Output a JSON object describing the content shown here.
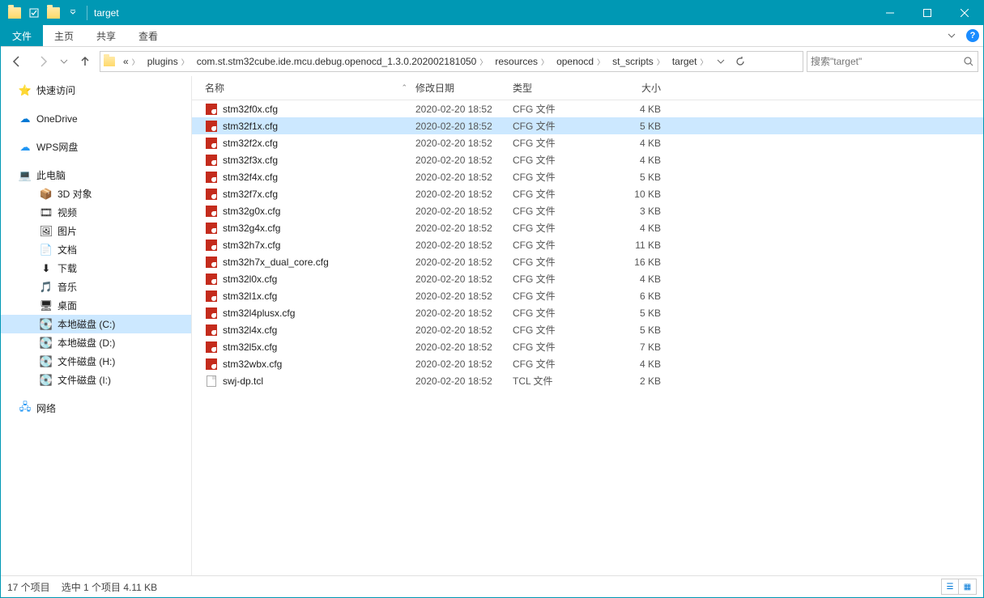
{
  "window": {
    "title": "target"
  },
  "ribbon": {
    "file": "文件",
    "home": "主页",
    "share": "共享",
    "view": "查看"
  },
  "breadcrumbs": [
    "«",
    "plugins",
    "com.st.stm32cube.ide.mcu.debug.openocd_1.3.0.202002181050",
    "resources",
    "openocd",
    "st_scripts",
    "target"
  ],
  "search": {
    "placeholder": "搜索\"target\""
  },
  "nav": {
    "quickaccess": "快速访问",
    "onedrive": "OneDrive",
    "wps": "WPS网盘",
    "thispc": "此电脑",
    "pc_items": [
      "3D 对象",
      "视频",
      "图片",
      "文档",
      "下载",
      "音乐",
      "桌面",
      "本地磁盘 (C:)",
      "本地磁盘 (D:)",
      "文件磁盘 (H:)",
      "文件磁盘 (I:)"
    ],
    "network": "网络"
  },
  "columns": {
    "name": "名称",
    "date": "修改日期",
    "type": "类型",
    "size": "大小"
  },
  "files": [
    {
      "name": "stm32f0x.cfg",
      "date": "2020-02-20 18:52",
      "type": "CFG 文件",
      "size": "4 KB",
      "icon": "cfg"
    },
    {
      "name": "stm32f1x.cfg",
      "date": "2020-02-20 18:52",
      "type": "CFG 文件",
      "size": "5 KB",
      "icon": "cfg",
      "selected": true
    },
    {
      "name": "stm32f2x.cfg",
      "date": "2020-02-20 18:52",
      "type": "CFG 文件",
      "size": "4 KB",
      "icon": "cfg"
    },
    {
      "name": "stm32f3x.cfg",
      "date": "2020-02-20 18:52",
      "type": "CFG 文件",
      "size": "4 KB",
      "icon": "cfg"
    },
    {
      "name": "stm32f4x.cfg",
      "date": "2020-02-20 18:52",
      "type": "CFG 文件",
      "size": "5 KB",
      "icon": "cfg"
    },
    {
      "name": "stm32f7x.cfg",
      "date": "2020-02-20 18:52",
      "type": "CFG 文件",
      "size": "10 KB",
      "icon": "cfg"
    },
    {
      "name": "stm32g0x.cfg",
      "date": "2020-02-20 18:52",
      "type": "CFG 文件",
      "size": "3 KB",
      "icon": "cfg"
    },
    {
      "name": "stm32g4x.cfg",
      "date": "2020-02-20 18:52",
      "type": "CFG 文件",
      "size": "4 KB",
      "icon": "cfg"
    },
    {
      "name": "stm32h7x.cfg",
      "date": "2020-02-20 18:52",
      "type": "CFG 文件",
      "size": "11 KB",
      "icon": "cfg"
    },
    {
      "name": "stm32h7x_dual_core.cfg",
      "date": "2020-02-20 18:52",
      "type": "CFG 文件",
      "size": "16 KB",
      "icon": "cfg"
    },
    {
      "name": "stm32l0x.cfg",
      "date": "2020-02-20 18:52",
      "type": "CFG 文件",
      "size": "4 KB",
      "icon": "cfg"
    },
    {
      "name": "stm32l1x.cfg",
      "date": "2020-02-20 18:52",
      "type": "CFG 文件",
      "size": "6 KB",
      "icon": "cfg"
    },
    {
      "name": "stm32l4plusx.cfg",
      "date": "2020-02-20 18:52",
      "type": "CFG 文件",
      "size": "5 KB",
      "icon": "cfg"
    },
    {
      "name": "stm32l4x.cfg",
      "date": "2020-02-20 18:52",
      "type": "CFG 文件",
      "size": "5 KB",
      "icon": "cfg"
    },
    {
      "name": "stm32l5x.cfg",
      "date": "2020-02-20 18:52",
      "type": "CFG 文件",
      "size": "7 KB",
      "icon": "cfg"
    },
    {
      "name": "stm32wbx.cfg",
      "date": "2020-02-20 18:52",
      "type": "CFG 文件",
      "size": "4 KB",
      "icon": "cfg"
    },
    {
      "name": "swj-dp.tcl",
      "date": "2020-02-20 18:52",
      "type": "TCL 文件",
      "size": "2 KB",
      "icon": "tcl"
    }
  ],
  "status": {
    "count": "17 个项目",
    "selected": "选中 1 个项目  4.11 KB"
  },
  "nav_selected_index": 7
}
